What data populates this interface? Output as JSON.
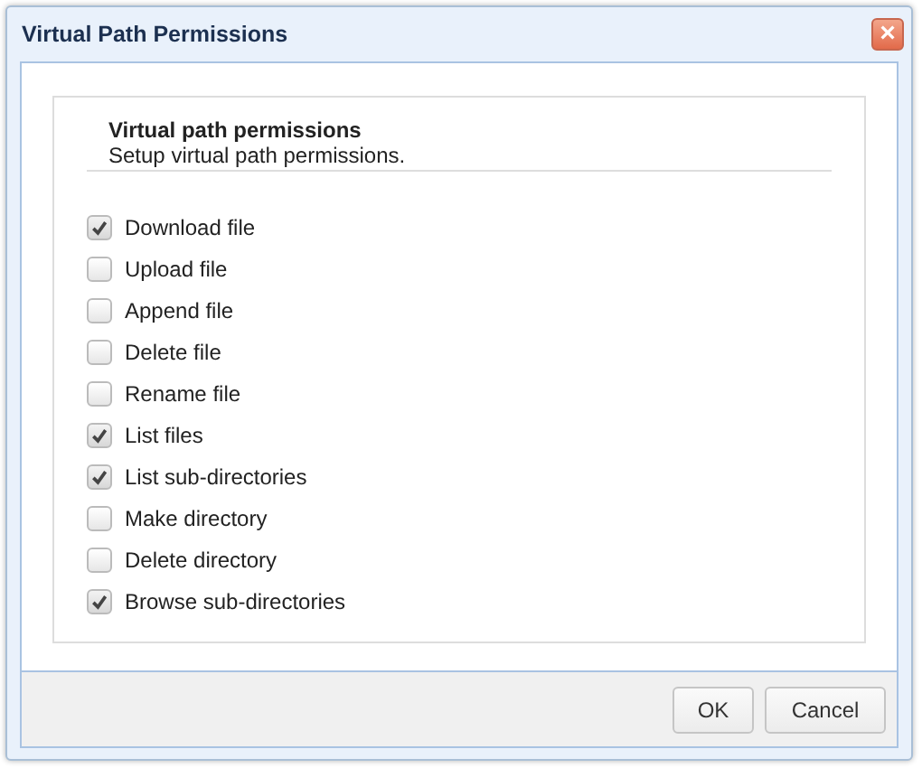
{
  "window": {
    "title": "Virtual Path Permissions",
    "close": "×"
  },
  "section": {
    "title": "Virtual path permissions",
    "description": "Setup virtual path permissions."
  },
  "permissions": [
    {
      "label": "Download file",
      "checked": true
    },
    {
      "label": "Upload file",
      "checked": false
    },
    {
      "label": "Append file",
      "checked": false
    },
    {
      "label": "Delete file",
      "checked": false
    },
    {
      "label": "Rename file",
      "checked": false
    },
    {
      "label": "List files",
      "checked": true
    },
    {
      "label": "List sub-directories",
      "checked": true
    },
    {
      "label": "Make directory",
      "checked": false
    },
    {
      "label": "Delete directory",
      "checked": false
    },
    {
      "label": "Browse sub-directories",
      "checked": true
    }
  ],
  "buttons": [
    "OK",
    "Cancel"
  ]
}
